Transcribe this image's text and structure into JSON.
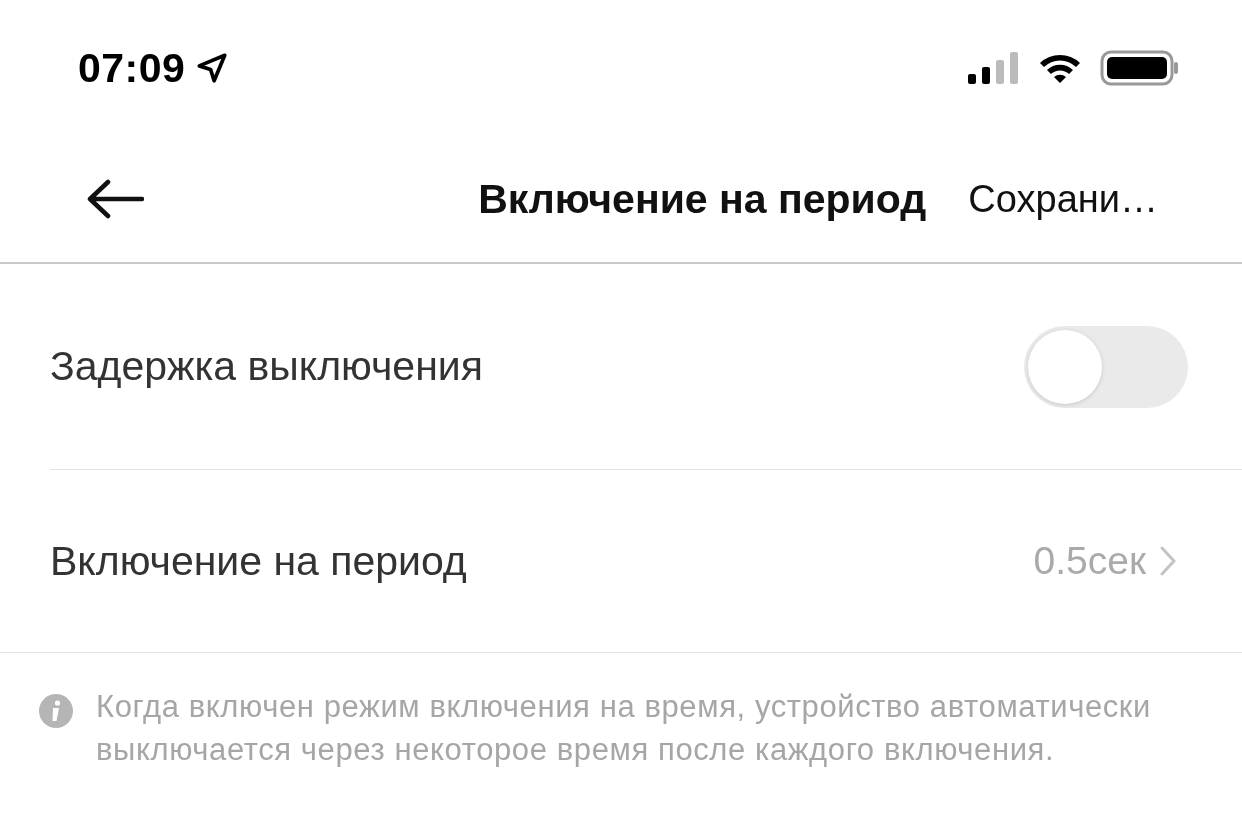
{
  "status_bar": {
    "time": "07:09"
  },
  "nav": {
    "title": "Включение на период",
    "action": "Сохрани…"
  },
  "rows": [
    {
      "kind": "toggle",
      "label": "Задержка выключения",
      "on": false
    },
    {
      "kind": "value",
      "label": "Включение на период",
      "value": "0.5сек"
    }
  ],
  "note": "Когда включен режим включения на время, устройство автоматически выключается через некоторое время после каждого включения."
}
